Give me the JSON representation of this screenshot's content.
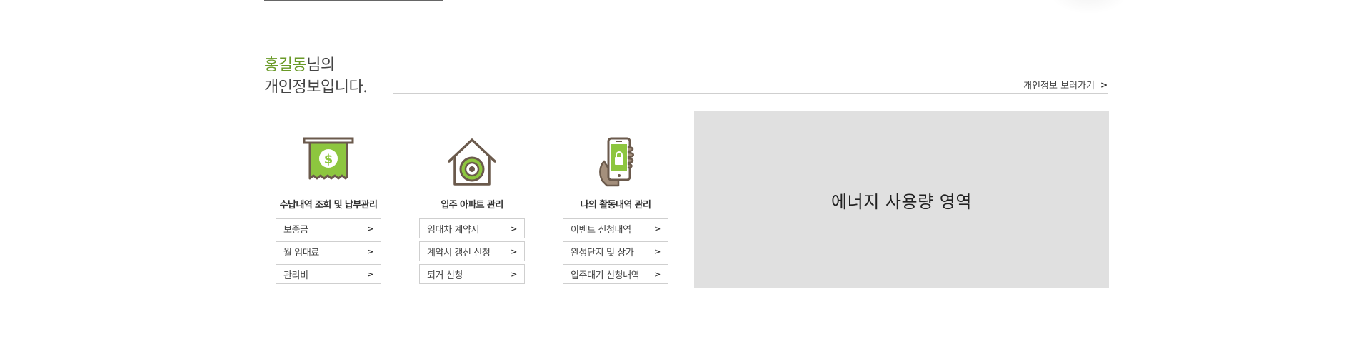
{
  "greeting": {
    "name": "홍길동",
    "suffix": "님의",
    "line2": "개인정보입니다."
  },
  "info_link": {
    "label": "개인정보 보러가기"
  },
  "columns": [
    {
      "icon": "receipt-dollar-icon",
      "title": "수납내역 조회 및 납부관리",
      "links": [
        "보증금",
        "월 임대료",
        "관리비"
      ]
    },
    {
      "icon": "house-safe-icon",
      "title": "입주 아파트 관리",
      "links": [
        "임대차 계약서",
        "계약서 갱신 신청",
        "퇴거 신청"
      ]
    },
    {
      "icon": "phone-lock-icon",
      "title": "나의 활동내역 관리",
      "links": [
        "이벤트 신청내역",
        "완성단지 및 상가",
        "입주대기 신청내역"
      ]
    }
  ],
  "energy": {
    "label": "에너지 사용량 영역"
  },
  "colors": {
    "accent": "#8dc63f",
    "name_green": "#6a9a28",
    "icon_brown": "#6b5a4c",
    "panel_gray": "#e0e0e0"
  }
}
